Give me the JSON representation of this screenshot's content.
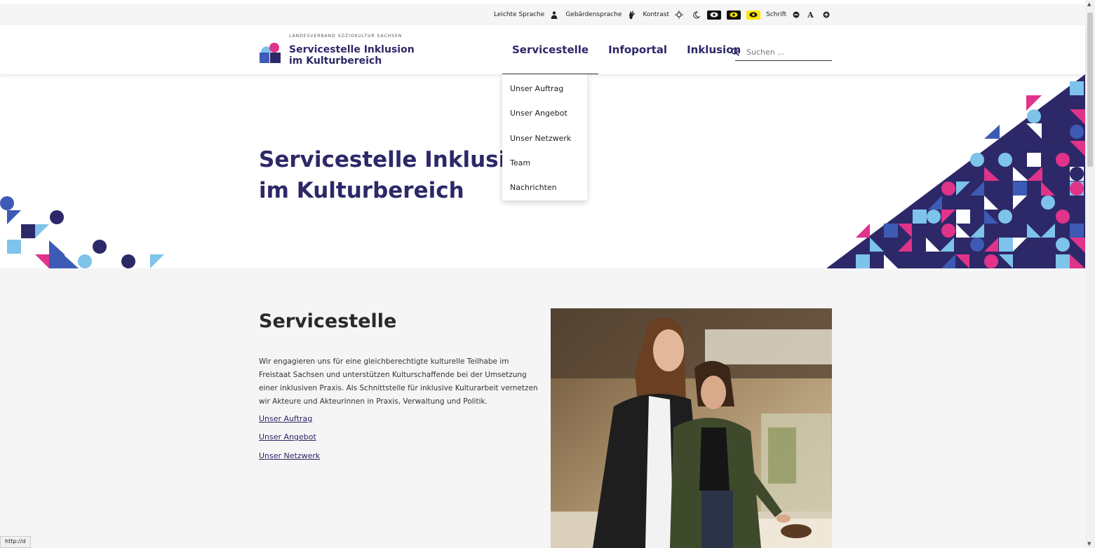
{
  "utility_bar": {
    "easy_language": "Leichte Sprache",
    "sign_language": "Gebärdensprache",
    "contrast": "Kontrast",
    "font_size": "Schrift",
    "font_icon": "A"
  },
  "logo": {
    "small_text": "LANDESVERBAND SOZIOKULTUR SACHSEN",
    "line1": "Servicestelle Inklusion",
    "line2": "im Kulturbereich"
  },
  "nav": {
    "items": [
      "Servicestelle",
      "Infoportal",
      "Inklusion"
    ]
  },
  "search": {
    "placeholder": "Suchen ..."
  },
  "dropdown": {
    "items": [
      "Unser Auftrag",
      "Unser Angebot",
      "Unser Netzwerk",
      "Team",
      "Nachrichten"
    ]
  },
  "hero": {
    "title_line1": "Servicestelle Inklusion",
    "title_line2": "im Kulturbereich"
  },
  "section": {
    "title": "Servicestelle",
    "text": "Wir engagieren uns für eine gleichberechtigte kulturelle Teilhabe im Freistaat Sachsen und unterstützen Kulturschaffende bei der Umsetzung einer inklusiven Praxis. Als Schnittstelle für inklusive Kulturarbeit vernetzen wir Akteure und Akteurinnen in Praxis, Verwaltung und Politik.",
    "links": [
      "Unser Auftrag",
      "Unser Angebot",
      "Unser Netzwerk"
    ]
  },
  "status_bar": "http://d",
  "colors": {
    "brand_dark": "#2d2868",
    "pink": "#e0338a",
    "light_blue": "#7ec3ea",
    "mid_blue": "#3d5bb5",
    "section_bg": "#f5f5f5"
  }
}
